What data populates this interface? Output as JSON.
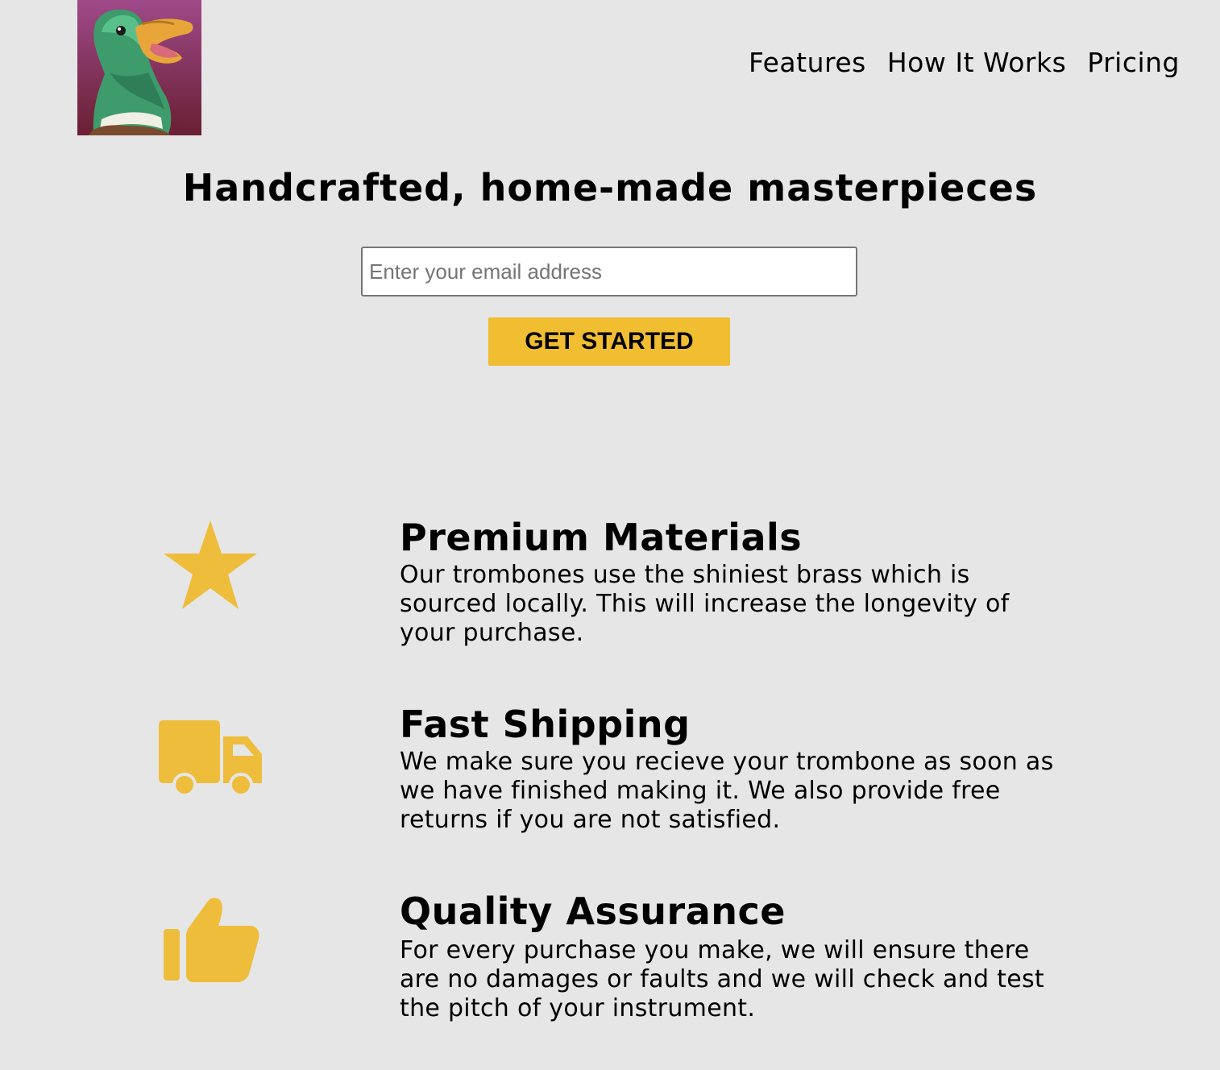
{
  "header": {
    "logo_alt": "Duck logo",
    "nav": [
      {
        "label": "Features"
      },
      {
        "label": "How It Works"
      },
      {
        "label": "Pricing"
      }
    ]
  },
  "hero": {
    "title": "Handcrafted, home-made masterpieces",
    "email_placeholder": "Enter your email address",
    "email_value": "",
    "button_label": "GET STARTED"
  },
  "features": [
    {
      "icon": "star-icon",
      "title": "Premium Materials",
      "description": "Our trombones use the shiniest brass which is sourced locally. This will increase the longevity of your purchase."
    },
    {
      "icon": "truck-icon",
      "title": "Fast Shipping",
      "description": "We make sure you recieve your trombone as soon as we have finished making it. We also provide free returns if you are not satisfied."
    },
    {
      "icon": "thumbs-up-icon",
      "title": "Quality Assurance",
      "description": "For every purchase you make, we will ensure there are no damages or faults and we will check and test the pitch of your instrument."
    }
  ],
  "colors": {
    "background": "#e6e6e6",
    "accent": "#f1be32",
    "icon": "#eebd3b"
  }
}
